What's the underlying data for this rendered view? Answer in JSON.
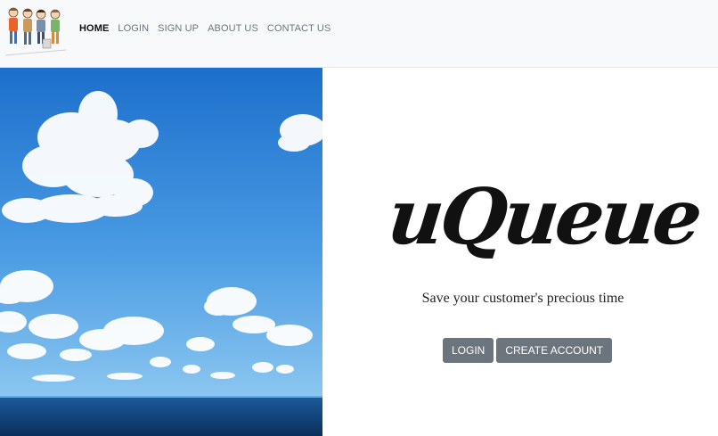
{
  "nav": {
    "items": [
      {
        "label": "HOME",
        "active": true
      },
      {
        "label": "LOGIN",
        "active": false
      },
      {
        "label": "SIGN UP",
        "active": false
      },
      {
        "label": "ABOUT US",
        "active": false
      },
      {
        "label": "CONTACT US",
        "active": false
      }
    ]
  },
  "hero": {
    "logo_text": "uQueue",
    "tagline": "Save your customer's precious time"
  },
  "actions": {
    "login_label": "LOGIN",
    "create_account_label": "CREATE ACCOUNT"
  },
  "colors": {
    "navbar_bg": "#f8f9fa",
    "button_bg": "#6c757d",
    "sky_top": "#1f78d1",
    "sky_bottom": "#7ec0ee",
    "sea": "#0d3f73"
  }
}
